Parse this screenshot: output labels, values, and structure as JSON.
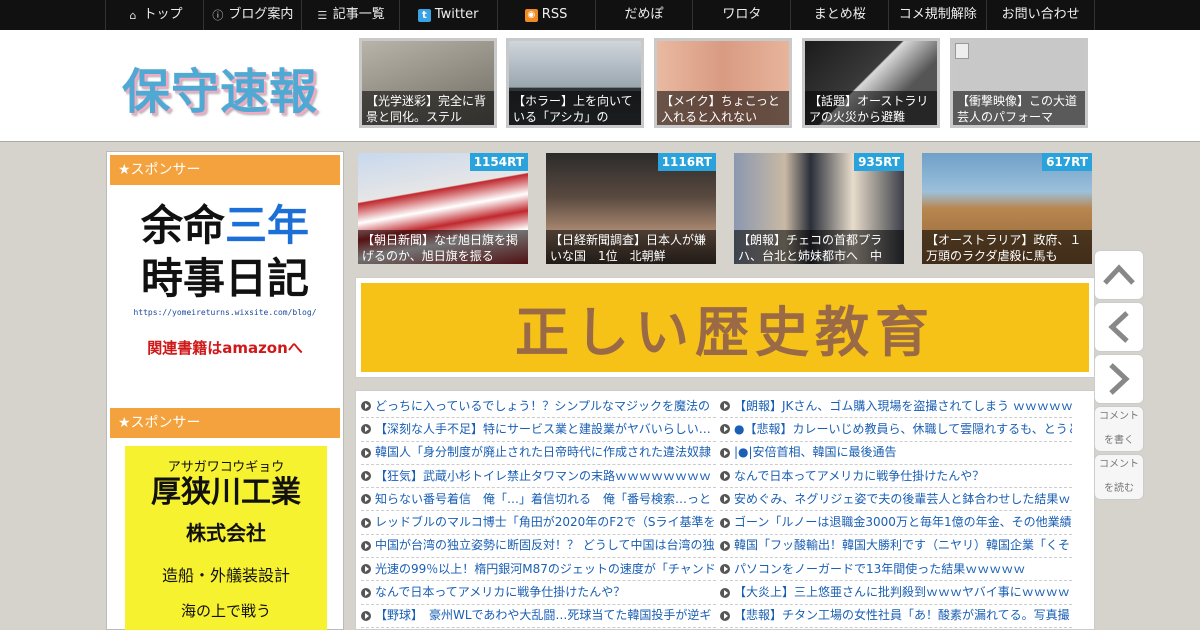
{
  "nav": [
    {
      "label": "トップ",
      "icon": "home-icon"
    },
    {
      "label": "ブログ案内",
      "icon": "info-icon"
    },
    {
      "label": "記事一覧",
      "icon": "list-icon"
    },
    {
      "label": "Twitter",
      "icon": "twitter-icon"
    },
    {
      "label": "RSS",
      "icon": "rss-icon"
    },
    {
      "label": "だめぽ"
    },
    {
      "label": "ワロタ"
    },
    {
      "label": "まとめ桜"
    },
    {
      "label": "コメ規制解除"
    },
    {
      "label": "お問い合わせ"
    }
  ],
  "site": {
    "logo": "保守速報"
  },
  "top_thumbs": [
    {
      "caption": "【光学迷彩】完全に背景と同化。ステル"
    },
    {
      "caption": "【ホラー】上を向いている「アシカ」の"
    },
    {
      "caption": "【メイク】ちょこっと入れると入れない"
    },
    {
      "caption": "【話題】オーストラリアの火災から避難"
    },
    {
      "caption": "【衝撃映像】この大道芸人のパフォーマ"
    }
  ],
  "rt_items": [
    {
      "count": "1154RT",
      "caption": "【朝日新聞】なぜ旭日旗を掲げるのか、旭日旗を振る"
    },
    {
      "count": "1116RT",
      "caption": "【日経新聞調査】日本人が嫌いな国　1位　北朝鮮"
    },
    {
      "count": "935RT",
      "caption": "【朗報】チェコの首都プラハ、台北と姉妹都市へ　中"
    },
    {
      "count": "617RT",
      "caption": "【オーストラリア】政府、１万頭のラクダ虐殺に馬も"
    }
  ],
  "sidebar": {
    "sponsor1": "★スポンサー",
    "sponsor2": "★スポンサー",
    "ad1": {
      "l1a": "余命",
      "l1b": "三年",
      "l2": "時事日記",
      "url": "https://yomeireturns.wixsite.com/blog/",
      "amz": "関連書籍はamazonへ"
    },
    "ad2": {
      "kana": "アサガワコウギョウ",
      "name": "厚狭川工業",
      "corp": "株式会社",
      "desc": "造船・外艤装設計",
      "extra": "海の上で戦う"
    }
  },
  "banner": "正しい歴史教育",
  "list_left": [
    "どっちに入っているでしょう！？シンプルなマジックを魔法の",
    "【深刻な人手不足】特にサービス業と建設業がヤバいらしい…",
    "韓国人「身分制度が廃止された日帝時代に作成された違法奴隷",
    "【狂気】武蔵小杉トイレ禁止タワマンの末路ｗｗｗｗｗｗｗｗ",
    "知らない番号着信　俺「…」着信切れる　俺「番号検索…っと",
    "レッドブルのマルコ博士「角田が2020年のF2で（Sライ基準を",
    "中国が台湾の独立姿勢に断固反対！？ どうして中国は台湾の独",
    "光速の99％以上！楕円銀河M87のジェットの速度が「チャンド",
    "なんで日本ってアメリカに戦争仕掛けたんや？",
    "【野球】　豪州WLであわや大乱闘…死球当てた韓国投手が逆ギ"
  ],
  "list_right": [
    "【朗報】JKさん、ゴム購入現場を盗撮されてしまう ｗｗｗｗｗ",
    "●【悲報】カレーいじめ教員ら、休職して雲隠れするも、とうと",
    "|●|安倍首相、韓国に最後通告",
    "なんで日本ってアメリカに戦争仕掛けたんや？",
    "安めぐみ、ネグリジェ姿で夫の後輩芸人と鉢合わせした結果ｗ",
    "ゴーン「ルノーは退職金3000万と毎年1億の年金、その他業績報",
    "韓国「フッ酸輸出！韓国大勝利です（ニヤリ）韓国企業「くそ",
    "パソコンをノーガードで13年間使った結果ｗｗｗｗｗ",
    "【大炎上】三上悠亜さんに批判殺到ｗｗｗヤバイ事にｗｗｗｗ",
    "【悲報】チタン工場の女性社員「あ！酸素が漏れてる。写真撮"
  ],
  "side_buttons": {
    "comment_write": "コメントを書く",
    "comment_read": "コメントを読む"
  }
}
